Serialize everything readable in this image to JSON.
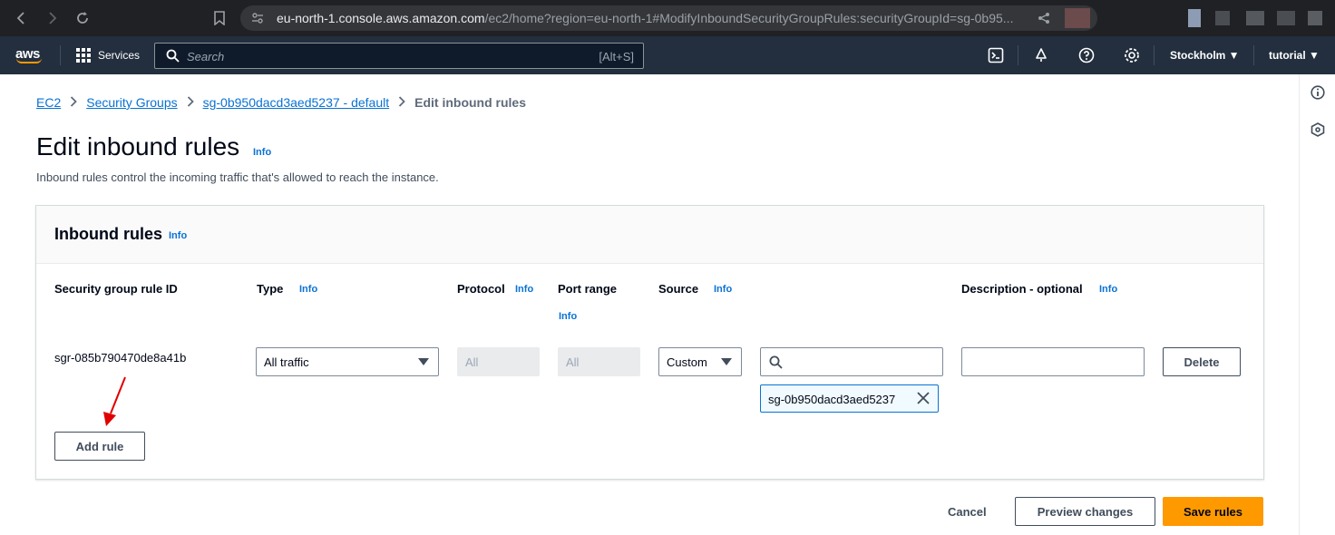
{
  "browser": {
    "url_host": "eu-north-1.console.aws.amazon.com",
    "url_path": "/ec2/home?region=eu-north-1#ModifyInboundSecurityGroupRules:securityGroupId=sg-0b95..."
  },
  "aws_nav": {
    "logo": "aws",
    "services_label": "Services",
    "search_placeholder": "Search",
    "search_shortcut": "[Alt+S]",
    "region": "Stockholm ▼",
    "account": "tutorial ▼"
  },
  "breadcrumb": {
    "items": [
      "EC2",
      "Security Groups",
      "sg-0b950dacd3aed5237 - default"
    ],
    "current": "Edit inbound rules"
  },
  "page": {
    "title": "Edit inbound rules",
    "title_info": "Info",
    "description": "Inbound rules control the incoming traffic that's allowed to reach the instance."
  },
  "panel": {
    "title": "Inbound rules",
    "title_info": "Info",
    "columns": {
      "rule_id": "Security group rule ID",
      "type": "Type",
      "protocol": "Protocol",
      "port_range": "Port range",
      "source": "Source",
      "description": "Description - optional",
      "info": "Info"
    },
    "rule": {
      "id": "sgr-085b790470de8a41b",
      "type": "All traffic",
      "protocol": "All",
      "port_range": "All",
      "source_type": "Custom",
      "source_search_value": "",
      "source_token": "sg-0b950dacd3aed5237",
      "description": "",
      "delete_label": "Delete"
    },
    "add_rule_label": "Add rule"
  },
  "footer": {
    "cancel_label": "Cancel",
    "preview_label": "Preview changes",
    "save_label": "Save rules"
  },
  "colors": {
    "link": "#0972d3",
    "primary": "#ff9900",
    "nav_bg": "#232f3e",
    "annotation": "#e00000"
  }
}
